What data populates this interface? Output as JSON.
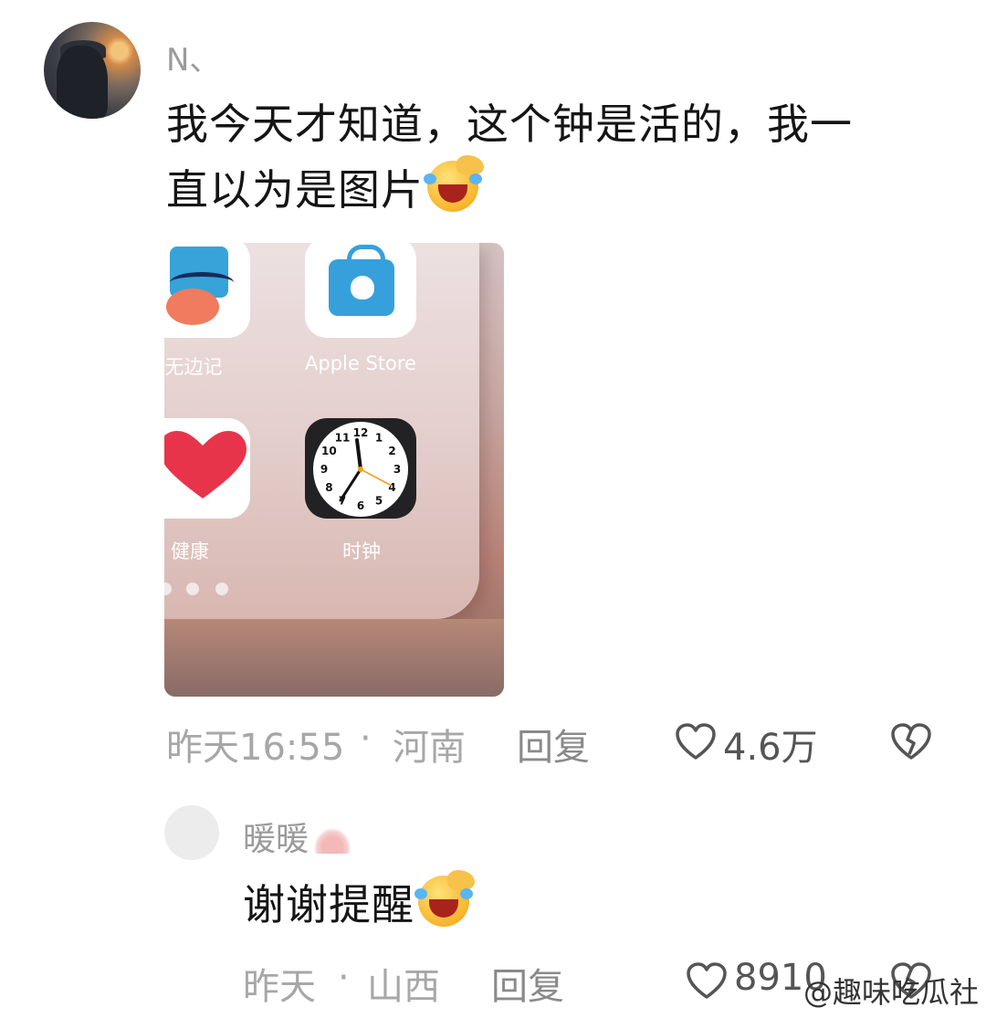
{
  "main_comment": {
    "username": "N、",
    "text_line1": "我今天才知道，这个钟是活的，我一",
    "text_line2": "直以为是图片",
    "emoji": "laughing-crying-emoji",
    "time": "昨天16:55",
    "separator": "·",
    "location": "河南",
    "reply_label": "回复",
    "like_count": "4.6万"
  },
  "screenshot": {
    "apps": [
      {
        "label": "无边记"
      },
      {
        "label": "Apple Store"
      },
      {
        "label": "健康"
      },
      {
        "label": "时钟"
      }
    ],
    "clock_numbers": [
      "12",
      "1",
      "2",
      "3",
      "4",
      "5",
      "6",
      "7",
      "8",
      "9",
      "10",
      "11"
    ]
  },
  "reply_comment": {
    "username": "暖暖",
    "text": "谢谢提醒",
    "time": "昨天",
    "separator": "·",
    "location": "山西",
    "reply_label": "回复",
    "like_count": "8910"
  },
  "watermark": "@趣味吃瓜社",
  "icons": {
    "like": "heart-outline-icon",
    "dislike": "broken-heart-icon"
  }
}
